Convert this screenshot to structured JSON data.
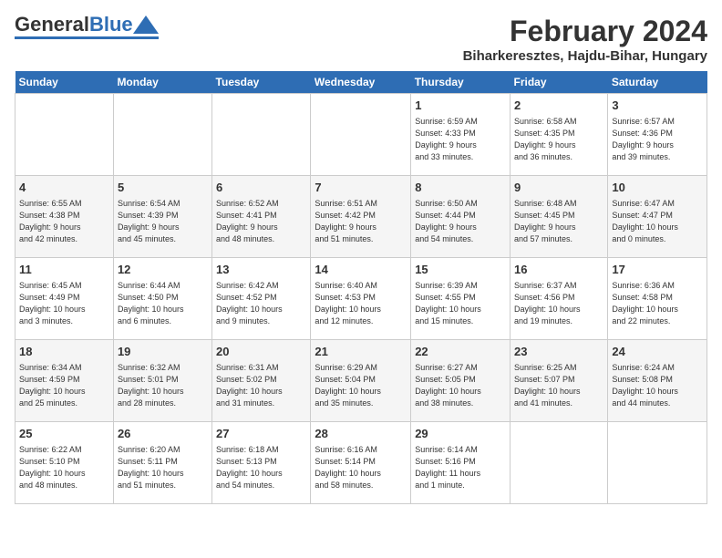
{
  "header": {
    "logo_general": "General",
    "logo_blue": "Blue",
    "month_title": "February 2024",
    "location": "Biharkeresztes, Hajdu-Bihar, Hungary"
  },
  "days_of_week": [
    "Sunday",
    "Monday",
    "Tuesday",
    "Wednesday",
    "Thursday",
    "Friday",
    "Saturday"
  ],
  "weeks": [
    [
      {
        "day": "",
        "info": ""
      },
      {
        "day": "",
        "info": ""
      },
      {
        "day": "",
        "info": ""
      },
      {
        "day": "",
        "info": ""
      },
      {
        "day": "1",
        "info": "Sunrise: 6:59 AM\nSunset: 4:33 PM\nDaylight: 9 hours\nand 33 minutes."
      },
      {
        "day": "2",
        "info": "Sunrise: 6:58 AM\nSunset: 4:35 PM\nDaylight: 9 hours\nand 36 minutes."
      },
      {
        "day": "3",
        "info": "Sunrise: 6:57 AM\nSunset: 4:36 PM\nDaylight: 9 hours\nand 39 minutes."
      }
    ],
    [
      {
        "day": "4",
        "info": "Sunrise: 6:55 AM\nSunset: 4:38 PM\nDaylight: 9 hours\nand 42 minutes."
      },
      {
        "day": "5",
        "info": "Sunrise: 6:54 AM\nSunset: 4:39 PM\nDaylight: 9 hours\nand 45 minutes."
      },
      {
        "day": "6",
        "info": "Sunrise: 6:52 AM\nSunset: 4:41 PM\nDaylight: 9 hours\nand 48 minutes."
      },
      {
        "day": "7",
        "info": "Sunrise: 6:51 AM\nSunset: 4:42 PM\nDaylight: 9 hours\nand 51 minutes."
      },
      {
        "day": "8",
        "info": "Sunrise: 6:50 AM\nSunset: 4:44 PM\nDaylight: 9 hours\nand 54 minutes."
      },
      {
        "day": "9",
        "info": "Sunrise: 6:48 AM\nSunset: 4:45 PM\nDaylight: 9 hours\nand 57 minutes."
      },
      {
        "day": "10",
        "info": "Sunrise: 6:47 AM\nSunset: 4:47 PM\nDaylight: 10 hours\nand 0 minutes."
      }
    ],
    [
      {
        "day": "11",
        "info": "Sunrise: 6:45 AM\nSunset: 4:49 PM\nDaylight: 10 hours\nand 3 minutes."
      },
      {
        "day": "12",
        "info": "Sunrise: 6:44 AM\nSunset: 4:50 PM\nDaylight: 10 hours\nand 6 minutes."
      },
      {
        "day": "13",
        "info": "Sunrise: 6:42 AM\nSunset: 4:52 PM\nDaylight: 10 hours\nand 9 minutes."
      },
      {
        "day": "14",
        "info": "Sunrise: 6:40 AM\nSunset: 4:53 PM\nDaylight: 10 hours\nand 12 minutes."
      },
      {
        "day": "15",
        "info": "Sunrise: 6:39 AM\nSunset: 4:55 PM\nDaylight: 10 hours\nand 15 minutes."
      },
      {
        "day": "16",
        "info": "Sunrise: 6:37 AM\nSunset: 4:56 PM\nDaylight: 10 hours\nand 19 minutes."
      },
      {
        "day": "17",
        "info": "Sunrise: 6:36 AM\nSunset: 4:58 PM\nDaylight: 10 hours\nand 22 minutes."
      }
    ],
    [
      {
        "day": "18",
        "info": "Sunrise: 6:34 AM\nSunset: 4:59 PM\nDaylight: 10 hours\nand 25 minutes."
      },
      {
        "day": "19",
        "info": "Sunrise: 6:32 AM\nSunset: 5:01 PM\nDaylight: 10 hours\nand 28 minutes."
      },
      {
        "day": "20",
        "info": "Sunrise: 6:31 AM\nSunset: 5:02 PM\nDaylight: 10 hours\nand 31 minutes."
      },
      {
        "day": "21",
        "info": "Sunrise: 6:29 AM\nSunset: 5:04 PM\nDaylight: 10 hours\nand 35 minutes."
      },
      {
        "day": "22",
        "info": "Sunrise: 6:27 AM\nSunset: 5:05 PM\nDaylight: 10 hours\nand 38 minutes."
      },
      {
        "day": "23",
        "info": "Sunrise: 6:25 AM\nSunset: 5:07 PM\nDaylight: 10 hours\nand 41 minutes."
      },
      {
        "day": "24",
        "info": "Sunrise: 6:24 AM\nSunset: 5:08 PM\nDaylight: 10 hours\nand 44 minutes."
      }
    ],
    [
      {
        "day": "25",
        "info": "Sunrise: 6:22 AM\nSunset: 5:10 PM\nDaylight: 10 hours\nand 48 minutes."
      },
      {
        "day": "26",
        "info": "Sunrise: 6:20 AM\nSunset: 5:11 PM\nDaylight: 10 hours\nand 51 minutes."
      },
      {
        "day": "27",
        "info": "Sunrise: 6:18 AM\nSunset: 5:13 PM\nDaylight: 10 hours\nand 54 minutes."
      },
      {
        "day": "28",
        "info": "Sunrise: 6:16 AM\nSunset: 5:14 PM\nDaylight: 10 hours\nand 58 minutes."
      },
      {
        "day": "29",
        "info": "Sunrise: 6:14 AM\nSunset: 5:16 PM\nDaylight: 11 hours\nand 1 minute."
      },
      {
        "day": "",
        "info": ""
      },
      {
        "day": "",
        "info": ""
      }
    ]
  ]
}
